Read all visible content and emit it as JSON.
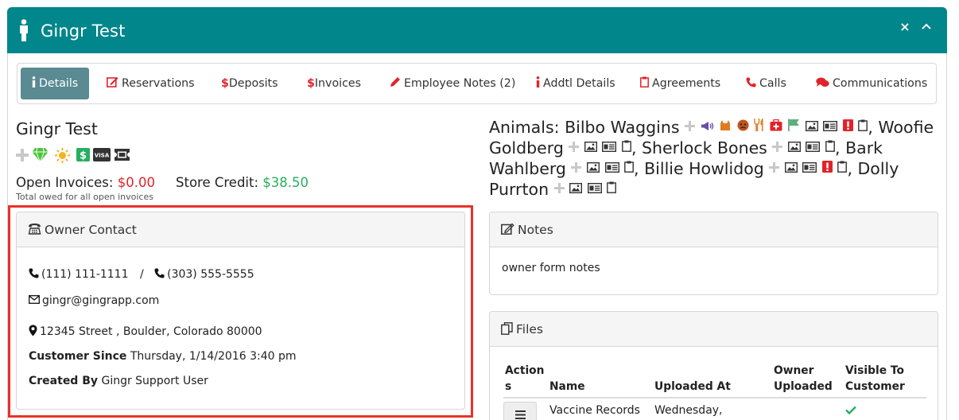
{
  "header": {
    "title": "Gingr Test",
    "close_label": "×"
  },
  "tabs": [
    {
      "label": "Details",
      "icon": "info-icon",
      "active": true
    },
    {
      "label": "Reservations",
      "icon": "edit-icon"
    },
    {
      "label": "Deposits",
      "icon": "dollar-icon"
    },
    {
      "label": "Invoices",
      "icon": "dollar-icon"
    },
    {
      "label": "Employee Notes (2)",
      "icon": "pencil-icon"
    },
    {
      "label": "Addtl Details",
      "icon": "info-icon"
    },
    {
      "label": "Agreements",
      "icon": "clipboard-icon"
    },
    {
      "label": "Calls",
      "icon": "phone-icon"
    },
    {
      "label": "Communications",
      "icon": "chat-icon"
    }
  ],
  "owner": {
    "name": "Gingr Test",
    "open_invoices_label": "Open Invoices:",
    "open_invoices_value": "$0.00",
    "store_credit_label": "Store Credit:",
    "store_credit_value": "$38.50",
    "owed_note": "Total owed for all open invoices",
    "badges": [
      "plus-icon",
      "diamond-icon",
      "sun-icon",
      "dollar-badge-icon",
      "visa-icon",
      "ticket-icon"
    ]
  },
  "contact": {
    "title": "Owner Contact",
    "phone1": "(111) 111-1111",
    "separator": "/",
    "phone2": "(303) 555-5555",
    "email": "gingr@gingrapp.com",
    "address": "12345 Street , Boulder, Colorado 80000",
    "customer_since_label": "Customer Since",
    "customer_since_value": "Thursday, 1/14/2016 3:40 pm",
    "created_by_label": "Created By",
    "created_by_value": "Gingr Support User"
  },
  "animals": {
    "label": "Animals:",
    "list": [
      {
        "name": "Bilbo Waggins",
        "suffix": ","
      },
      {
        "name": "Woofie Goldberg",
        "suffix": ","
      },
      {
        "name": "Sherlock Bones",
        "suffix": ","
      },
      {
        "name": "Bark Wahlberg",
        "suffix": ","
      },
      {
        "name": "Billie Howlidog",
        "suffix": ","
      },
      {
        "name": "Dolly Purrton",
        "suffix": ""
      }
    ]
  },
  "notes": {
    "title": "Notes",
    "text": "owner form notes"
  },
  "files": {
    "title": "Files",
    "columns": [
      "Action s",
      "Name",
      "Uploaded At",
      "Owner Uploaded",
      "Visible To Customer"
    ],
    "rows": [
      {
        "name": "Vaccine Records",
        "uploaded_at": "Wednesday,",
        "owner_uploaded": "",
        "visible": true
      }
    ]
  },
  "colors": {
    "header": "#00868b",
    "active_tab": "#5a8a92",
    "red": "#e0242a",
    "green": "#27ae60",
    "highlight": "#e8322a"
  }
}
